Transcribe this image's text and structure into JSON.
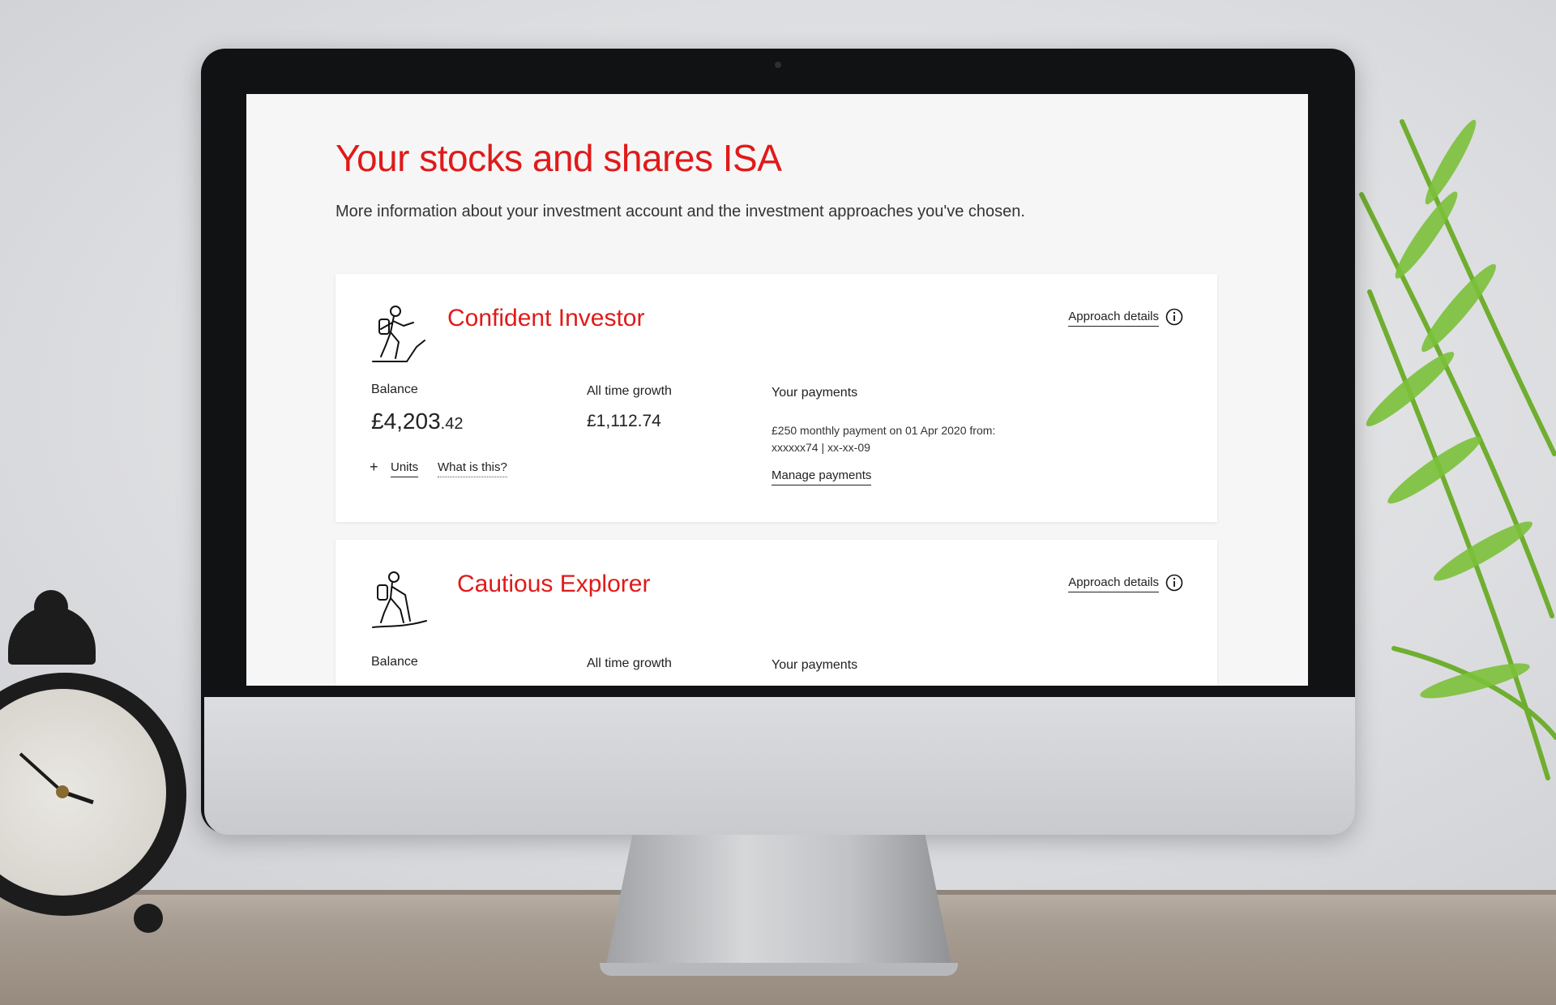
{
  "page": {
    "title": "Your stocks and shares ISA",
    "subtitle": "More information about your investment account and the investment approaches you've chosen."
  },
  "cards": [
    {
      "title": "Confident Investor",
      "approach_link": "Approach details",
      "balance_label": "Balance",
      "balance_main": "£4,203",
      "balance_pence": ".42",
      "growth_label": "All time growth",
      "growth_value": "£1,112.74",
      "payments_label": "Your payments",
      "payment_line1": "£250 monthly payment on 01 Apr 2020 from:",
      "payment_line2": "xxxxxx74  |  xx-xx-09",
      "manage_link": "Manage payments",
      "units_plus": "+",
      "units_link": "Units",
      "what_is_this": "What is this?"
    },
    {
      "title": "Cautious Explorer",
      "approach_link": "Approach details",
      "balance_label": "Balance",
      "growth_label": "All time growth",
      "payments_label": "Your payments"
    }
  ],
  "icons": {
    "investor": "hiker-climbing-icon",
    "explorer": "hiker-walking-icon",
    "info": "info-icon"
  },
  "colors": {
    "accent": "#e01a1a",
    "text": "#222222",
    "card_bg": "#ffffff",
    "page_bg": "#f6f6f6"
  }
}
